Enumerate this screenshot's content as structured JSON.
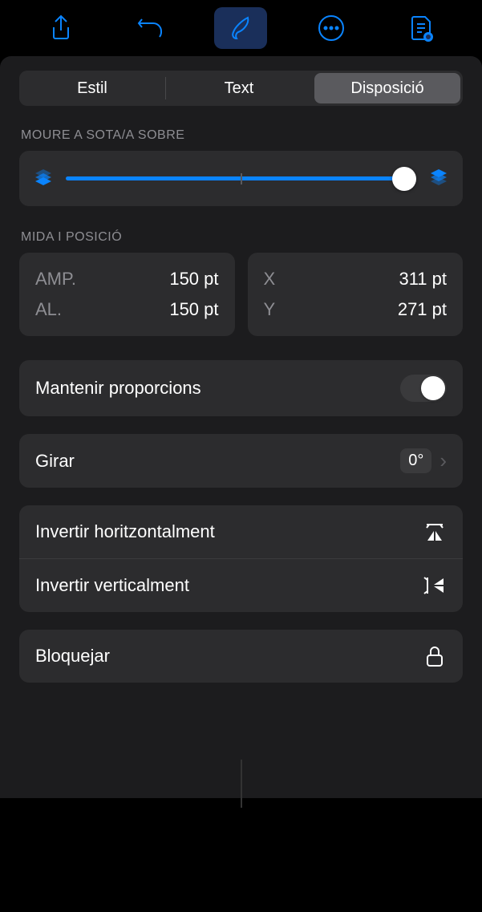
{
  "toolbar": {
    "share": "share-icon",
    "undo": "undo-icon",
    "format": "format-brush-icon",
    "more": "more-icon",
    "doc": "document-icon"
  },
  "tabs": {
    "style": "Estil",
    "text": "Text",
    "layout": "Disposició"
  },
  "sections": {
    "layer_label": "MOURE A SOTA/A SOBRE",
    "size_label": "MIDA I POSICIÓ"
  },
  "size": {
    "width_label": "AMP.",
    "width_value": "150 pt",
    "height_label": "AL.",
    "height_value": "150 pt",
    "x_label": "X",
    "x_value": "311 pt",
    "y_label": "Y",
    "y_value": "271 pt"
  },
  "rows": {
    "constrain": "Mantenir proporcions",
    "rotate": "Girar",
    "rotate_value": "0°",
    "flip_h": "Invertir horitzontalment",
    "flip_v": "Invertir verticalment",
    "lock": "Bloquejar"
  }
}
